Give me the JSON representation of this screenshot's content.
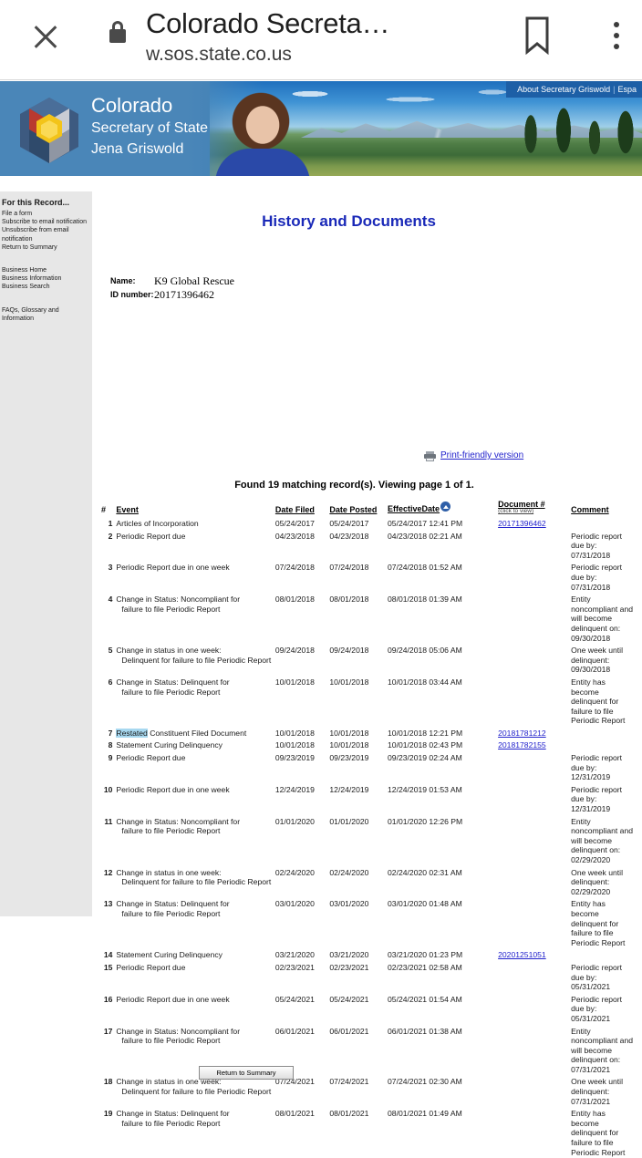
{
  "browser": {
    "close_icon": "close-icon",
    "lock_icon": "lock-icon",
    "tab_title": "Colorado Secreta…",
    "url": "w.sos.state.co.us",
    "bookmark_icon": "bookmark-icon",
    "menu_icon": "overflow-menu-icon"
  },
  "banner": {
    "state": "Colorado",
    "office": "Secretary of State",
    "official": "Jena Griswold",
    "topnav": {
      "about": "About Secretary Griswold",
      "separator": "|",
      "language": "Espa"
    }
  },
  "sidebar": {
    "heading": "For this Record...",
    "group1": [
      "File a form",
      "Subscribe to email notification",
      "Unsubscribe from email notification",
      "Return to Summary"
    ],
    "group2": [
      "Business Home",
      "Business Information",
      "Business Search"
    ],
    "group3": [
      "FAQs, Glossary and Information"
    ]
  },
  "main": {
    "title": "History and Documents",
    "name_label": "Name:",
    "name_value": "K9 Global Rescue",
    "id_label": "ID number:",
    "id_value": "20171396462",
    "print_link": "Print-friendly version",
    "printer_icon": "printer-icon",
    "found_text": "Found 19 matching record(s).  Viewing page 1 of 1.",
    "return_button": "Return to Summary",
    "highlight_term": "Restated",
    "accent_color": "#1a29b8",
    "link_color": "#2222cc",
    "highlight_color": "#a7d8f0"
  },
  "table": {
    "headers": {
      "num": "#",
      "event": "Event",
      "date_filed": "Date Filed",
      "date_posted": "Date Posted",
      "effective_date": "EffectiveDate",
      "sort_icon": "sort-ascending-icon",
      "document": "Document #",
      "document_sub": "(click to view)",
      "comment": "Comment"
    },
    "rows": [
      {
        "num": "1",
        "event": "Articles of Incorporation",
        "event2": "",
        "filed": "05/24/2017",
        "posted": "05/24/2017",
        "effective": "05/24/2017 12:41 PM",
        "doc": "20171396462",
        "comment": ""
      },
      {
        "num": "2",
        "event": "Periodic Report due",
        "event2": "",
        "filed": "04/23/2018",
        "posted": "04/23/2018",
        "effective": "04/23/2018 02:21 AM",
        "doc": "",
        "comment": "Periodic report due by: 07/31/2018"
      },
      {
        "num": "3",
        "event": "Periodic Report due in one week",
        "event2": "",
        "filed": "07/24/2018",
        "posted": "07/24/2018",
        "effective": "07/24/2018 01:52 AM",
        "doc": "",
        "comment": "Periodic report due by: 07/31/2018"
      },
      {
        "num": "4",
        "event": "Change in Status: Noncompliant for",
        "event2": "failure to file Periodic Report",
        "filed": "08/01/2018",
        "posted": "08/01/2018",
        "effective": "08/01/2018 01:39 AM",
        "doc": "",
        "comment": "Entity noncompliant and will become delinquent on: 09/30/2018"
      },
      {
        "num": "5",
        "event": "Change in status in one week:",
        "event2": "Delinquent for failure to file Periodic Report",
        "filed": "09/24/2018",
        "posted": "09/24/2018",
        "effective": "09/24/2018 05:06 AM",
        "doc": "",
        "comment": "One week until delinquent: 09/30/2018"
      },
      {
        "num": "6",
        "event": "Change in Status: Delinquent for",
        "event2": "failure to file Periodic Report",
        "filed": "10/01/2018",
        "posted": "10/01/2018",
        "effective": "10/01/2018 03:44 AM",
        "doc": "",
        "comment": "Entity has become delinquent for failure to file Periodic Report"
      },
      {
        "num": "7",
        "event": "Restated Constituent Filed Document",
        "event2": "",
        "filed": "10/01/2018",
        "posted": "10/01/2018",
        "effective": "10/01/2018 12:21 PM",
        "doc": "20181781212",
        "comment": ""
      },
      {
        "num": "8",
        "event": "Statement Curing Delinquency",
        "event2": "",
        "filed": "10/01/2018",
        "posted": "10/01/2018",
        "effective": "10/01/2018 02:43 PM",
        "doc": "20181782155",
        "comment": ""
      },
      {
        "num": "9",
        "event": "Periodic Report due",
        "event2": "",
        "filed": "09/23/2019",
        "posted": "09/23/2019",
        "effective": "09/23/2019 02:24 AM",
        "doc": "",
        "comment": "Periodic report due by: 12/31/2019"
      },
      {
        "num": "10",
        "event": "Periodic Report due in one week",
        "event2": "",
        "filed": "12/24/2019",
        "posted": "12/24/2019",
        "effective": "12/24/2019 01:53 AM",
        "doc": "",
        "comment": "Periodic report due by: 12/31/2019"
      },
      {
        "num": "11",
        "event": "Change in Status: Noncompliant for",
        "event2": "failure to file Periodic Report",
        "filed": "01/01/2020",
        "posted": "01/01/2020",
        "effective": "01/01/2020 12:26 PM",
        "doc": "",
        "comment": "Entity noncompliant and will become delinquent on: 02/29/2020"
      },
      {
        "num": "12",
        "event": "Change in status in one week:",
        "event2": "Delinquent for failure to file Periodic Report",
        "filed": "02/24/2020",
        "posted": "02/24/2020",
        "effective": "02/24/2020 02:31 AM",
        "doc": "",
        "comment": "One week until delinquent: 02/29/2020"
      },
      {
        "num": "13",
        "event": "Change in Status: Delinquent for",
        "event2": "failure to file Periodic Report",
        "filed": "03/01/2020",
        "posted": "03/01/2020",
        "effective": "03/01/2020 01:48 AM",
        "doc": "",
        "comment": "Entity has become delinquent for failure to file Periodic Report"
      },
      {
        "num": "14",
        "event": "Statement Curing Delinquency",
        "event2": "",
        "filed": "03/21/2020",
        "posted": "03/21/2020",
        "effective": "03/21/2020 01:23 PM",
        "doc": "20201251051",
        "comment": ""
      },
      {
        "num": "15",
        "event": "Periodic Report due",
        "event2": "",
        "filed": "02/23/2021",
        "posted": "02/23/2021",
        "effective": "02/23/2021 02:58 AM",
        "doc": "",
        "comment": "Periodic report due by: 05/31/2021"
      },
      {
        "num": "16",
        "event": "Periodic Report due in one week",
        "event2": "",
        "filed": "05/24/2021",
        "posted": "05/24/2021",
        "effective": "05/24/2021 01:54 AM",
        "doc": "",
        "comment": "Periodic report due by: 05/31/2021"
      },
      {
        "num": "17",
        "event": "Change in Status: Noncompliant for",
        "event2": "failure to file Periodic Report",
        "filed": "06/01/2021",
        "posted": "06/01/2021",
        "effective": "06/01/2021 01:38 AM",
        "doc": "",
        "comment": "Entity noncompliant and will become delinquent on: 07/31/2021"
      },
      {
        "num": "18",
        "event": "Change in status in one week:",
        "event2": "Delinquent for failure to file Periodic Report",
        "filed": "07/24/2021",
        "posted": "07/24/2021",
        "effective": "07/24/2021 02:30 AM",
        "doc": "",
        "comment": "One week until delinquent: 07/31/2021"
      },
      {
        "num": "19",
        "event": "Change in Status: Delinquent for",
        "event2": "failure to file Periodic Report",
        "filed": "08/01/2021",
        "posted": "08/01/2021",
        "effective": "08/01/2021 01:49 AM",
        "doc": "",
        "comment": "Entity has become delinquent for failure to file Periodic Report"
      }
    ]
  }
}
